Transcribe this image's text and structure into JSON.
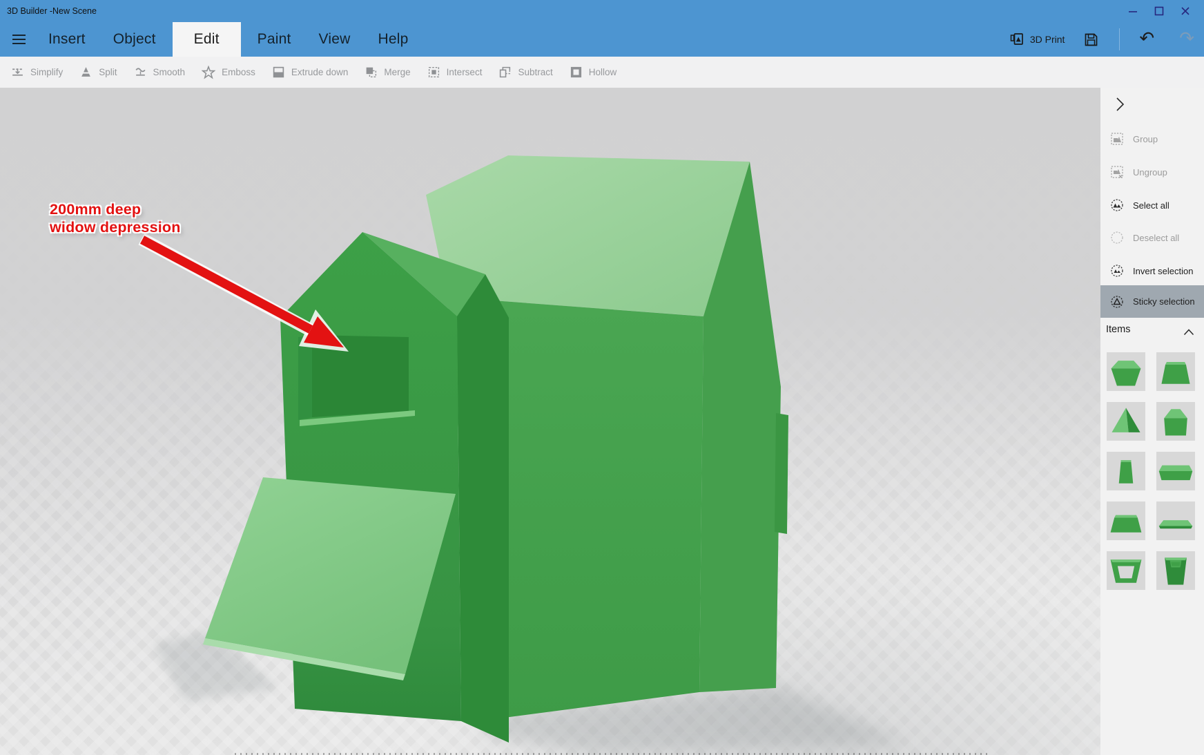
{
  "window": {
    "title": "3D Builder -New Scene"
  },
  "menu": {
    "items": [
      "Insert",
      "Object",
      "Edit",
      "Paint",
      "View",
      "Help"
    ],
    "active_item": "Edit"
  },
  "quick_actions": {
    "print_label": "3D Print"
  },
  "toolbar": {
    "state": "disabled",
    "items": [
      "Simplify",
      "Split",
      "Smooth",
      "Emboss",
      "Extrude down",
      "Merge",
      "Intersect",
      "Subtract",
      "Hollow"
    ]
  },
  "annotation": {
    "line1": "200mm deep",
    "line2": "widow depression"
  },
  "side_panel": {
    "buttons": [
      {
        "label": "Group",
        "enabled": false
      },
      {
        "label": "Ungroup",
        "enabled": false
      },
      {
        "label": "Select all",
        "enabled": true
      },
      {
        "label": "Deselect all",
        "enabled": false
      },
      {
        "label": "Invert selection",
        "enabled": true
      },
      {
        "label": "Sticky selection",
        "enabled": true,
        "active": true
      }
    ],
    "items_header": "Items",
    "items": [
      "hexagonal-block",
      "trapezoid-block",
      "corner-wedge",
      "house-block",
      "narrow-box",
      "flat-slab",
      "wide-trapezoid-block",
      "flat-plate",
      "trapezoid-frame",
      "open-box"
    ]
  },
  "colors": {
    "titlebar_blue": "#4d95d1",
    "menu_active_bg": "#f5f5f5",
    "toolbar_bg": "#f1f1f2",
    "panel_bg": "#f2f2f2",
    "sticky_active_bg": "#9fa8b0",
    "model_green": "#3da047",
    "model_roof_light": "#9cd39d",
    "annotation_red": "#e31212"
  }
}
